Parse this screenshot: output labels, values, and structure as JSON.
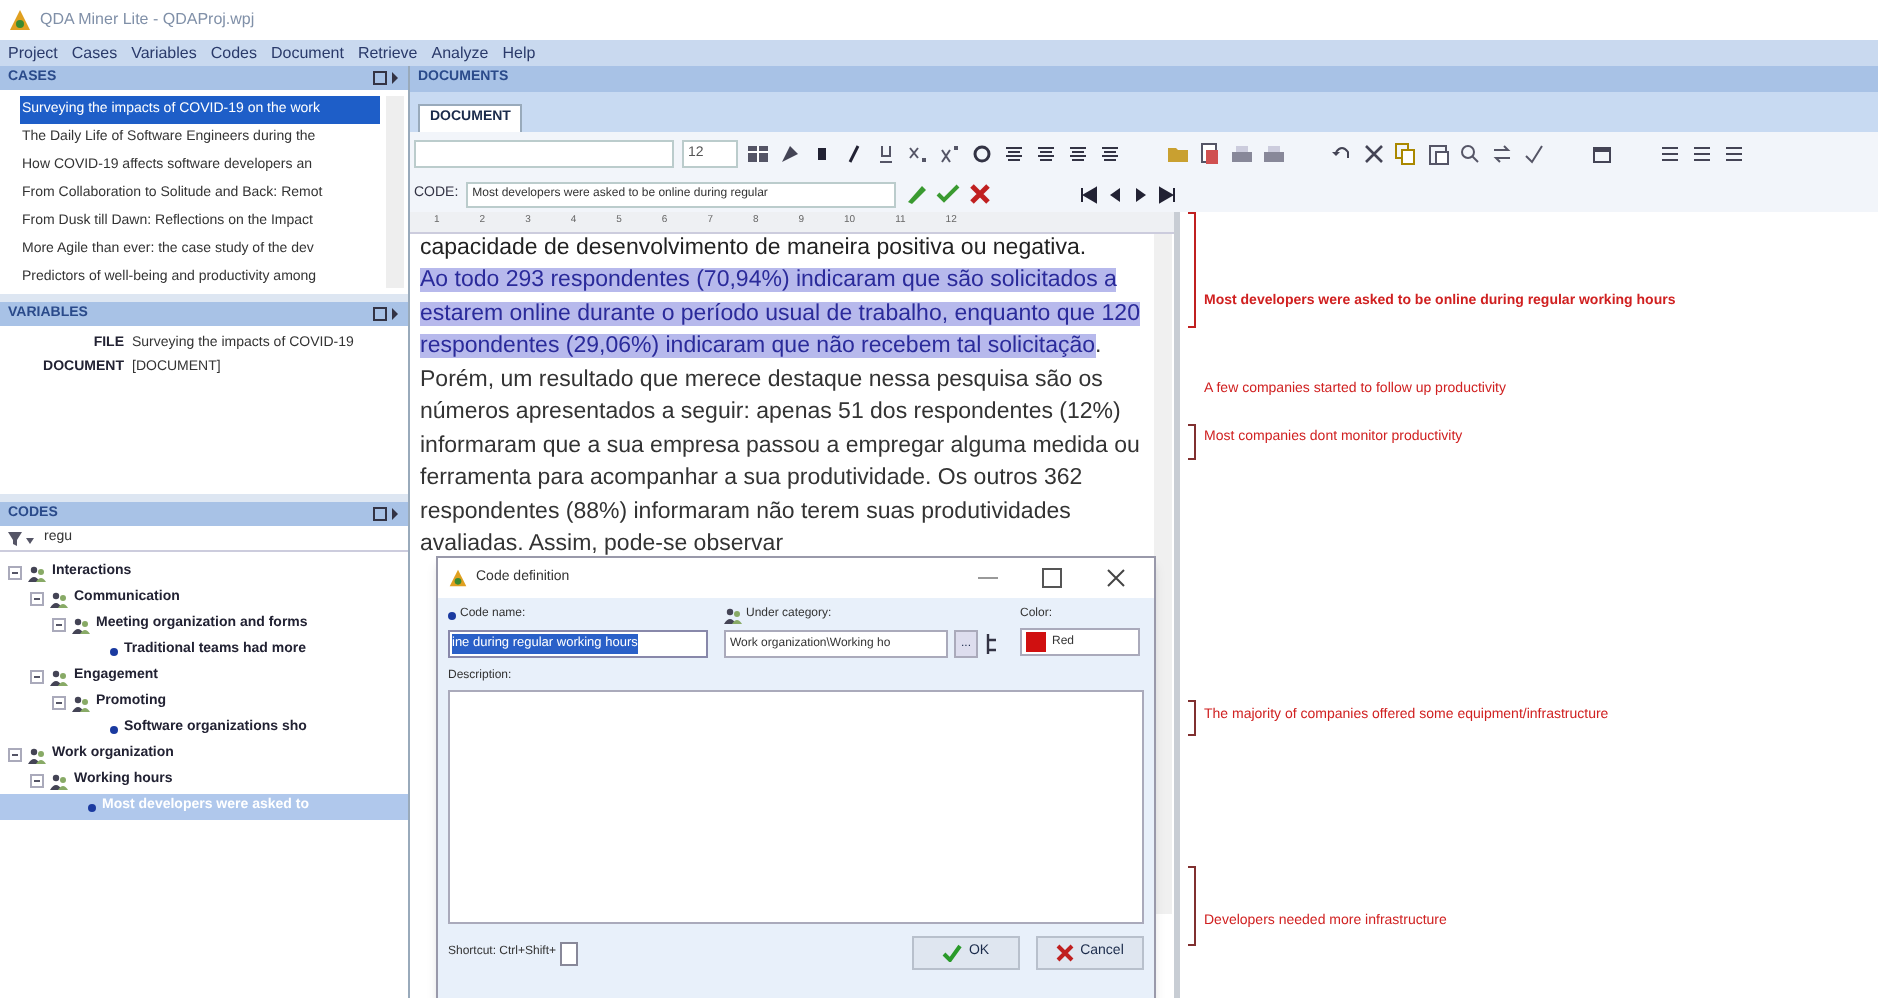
{
  "window": {
    "title": "QDA Miner Lite - QDAProj.wpj"
  },
  "menu": [
    "Project",
    "Cases",
    "Variables",
    "Codes",
    "Document",
    "Retrieve",
    "Analyze",
    "Help"
  ],
  "cases": {
    "title": "CASES",
    "items": [
      {
        "label": "Surveying the impacts of COVID-19 on the work",
        "selected": true
      },
      {
        "label": "The Daily Life of Software Engineers during the",
        "selected": false
      },
      {
        "label": "How COVID-19 affects software developers an",
        "selected": false
      },
      {
        "label": "From Collaboration to Solitude and Back: Remot",
        "selected": false
      },
      {
        "label": "From Dusk till Dawn: Reflections on the Impact",
        "selected": false
      },
      {
        "label": "More Agile than ever: the case study of the dev",
        "selected": false
      },
      {
        "label": "Predictors of well-being and productivity among",
        "selected": false
      }
    ]
  },
  "variables": {
    "title": "VARIABLES",
    "rows": [
      {
        "name": "FILE",
        "value": "Surveying the impacts of COVID-19"
      },
      {
        "name": "DOCUMENT",
        "value": "[DOCUMENT]"
      }
    ]
  },
  "codes": {
    "title": "CODES",
    "filter": "regu",
    "tree": [
      {
        "label": "Interactions",
        "kind": "category",
        "expanded": true,
        "selected": false,
        "children": [
          {
            "label": "Communication",
            "kind": "category",
            "expanded": true,
            "selected": false,
            "children": [
              {
                "label": "Meeting organization and forms",
                "kind": "category",
                "expanded": true,
                "selected": false,
                "children": [
                  {
                    "label": "Traditional teams had more",
                    "kind": "code",
                    "selected": false
                  }
                ]
              }
            ]
          },
          {
            "label": "Engagement",
            "kind": "category",
            "expanded": true,
            "selected": false,
            "children": [
              {
                "label": "Promoting",
                "kind": "category",
                "expanded": true,
                "selected": false,
                "children": [
                  {
                    "label": "Software organizations sho",
                    "kind": "code",
                    "selected": false
                  }
                ]
              }
            ]
          }
        ]
      },
      {
        "label": "Work organization",
        "kind": "category",
        "expanded": true,
        "selected": false,
        "children": [
          {
            "label": "Working hours",
            "kind": "category",
            "expanded": true,
            "selected": false,
            "children": [
              {
                "label": "Most developers were asked to",
                "kind": "code",
                "selected": true
              }
            ]
          }
        ]
      }
    ]
  },
  "documents": {
    "title": "DOCUMENTS",
    "tabs": [
      {
        "label": "DOCUMENT",
        "selected": true
      }
    ],
    "font_size": "12",
    "code_label": "CODE:",
    "code_value": "Most developers were asked to be online during regular",
    "ruler": [
      "1",
      "2",
      "3",
      "4",
      "5",
      "6",
      "7",
      "8",
      "9",
      "10",
      "11",
      "12"
    ],
    "text_cut": "capacidade de desenvolvimento de maneira positiva ou negativa.",
    "segments": [
      {
        "text": "Ao todo 293 respondentes (70,94%) indicaram que são solicitados a estarem online durante o período usual de trabalho, enquanto que 120 respondentes (29,06%) indicaram que não recebem tal solicitação",
        "highlighted": true
      },
      {
        "text": ". Porém, um resultado que merece destaque nessa pesquisa são os números apresentados a seguir: apenas 51 dos respondentes (12%) informaram que a sua empresa passou a empregar alguma medida ou ferramenta para acompanhar a sua produtividade. Os outros 362 respondentes (88%) informaram não terem suas produtividades avaliadas. Assim, pode-se observar",
        "highlighted": false
      }
    ],
    "margin_codes": [
      {
        "label": "Most developers were asked to be online during regular working hours",
        "bold": true
      },
      {
        "label": "A few companies started to follow up productivity",
        "bold": false
      },
      {
        "label": "Most companies dont monitor productivity",
        "bold": false
      },
      {
        "label": "The majority of companies offered some equipment/infrastructure",
        "bold": false
      },
      {
        "label": "Developers needed more infrastructure",
        "bold": false
      }
    ]
  },
  "dialog": {
    "title": "Code definition",
    "code_name_label": "Code name:",
    "code_name": "ine during regular working hours",
    "category_label": "Under category:",
    "category": "Work organization\\Working ho",
    "browse": "...",
    "color_label": "Color:",
    "color_name": "Red",
    "color": "#d01010",
    "description_label": "Description:",
    "shortcut_label": "Shortcut: Ctrl+Shift+",
    "ok": "OK",
    "cancel": "Cancel"
  }
}
